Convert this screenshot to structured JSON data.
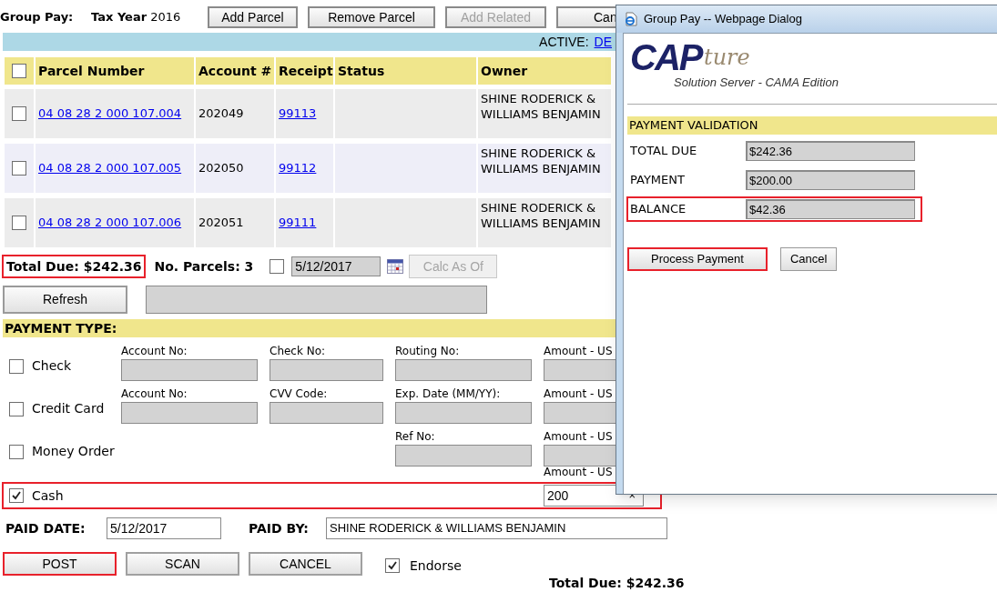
{
  "header": {
    "title": "Group Pay:",
    "tax_year_label": "Tax Year",
    "tax_year": "2016"
  },
  "toolbar": [
    {
      "label": "Add Parcel",
      "disabled": false
    },
    {
      "label": "Remove Parcel",
      "disabled": false
    },
    {
      "label": "Add Related",
      "disabled": true
    },
    {
      "label": "Can",
      "disabled": false
    }
  ],
  "active_bar": {
    "label": "ACTIVE:",
    "link": "DE"
  },
  "table": {
    "all_checked": false,
    "columns": [
      "Parcel Number",
      "Account #",
      "Receipt",
      "Status",
      "Owner"
    ],
    "rows": [
      {
        "checked": false,
        "parcel": "04 08 28 2 000 107.004",
        "account": "202049",
        "receipt": "99113",
        "owner": "SHINE RODERICK & WILLIAMS BENJAMIN"
      },
      {
        "checked": false,
        "parcel": "04 08 28 2 000 107.005",
        "account": "202050",
        "receipt": "99112",
        "owner": "SHINE RODERICK & WILLIAMS BENJAMIN"
      },
      {
        "checked": false,
        "parcel": "04 08 28 2 000 107.006",
        "account": "202051",
        "receipt": "99111",
        "owner": "SHINE RODERICK & WILLIAMS BENJAMIN"
      }
    ]
  },
  "summary": {
    "total_due": "Total Due: $242.36",
    "total_highlighted": true,
    "parcels": "No. Parcels: 3",
    "calc_checked": false,
    "calc_date": "5/12/2017",
    "calc_button": {
      "label": "Calc As Of",
      "disabled": true
    },
    "refresh": "Refresh"
  },
  "payment": {
    "title": "PAYMENT TYPE:",
    "methods": [
      {
        "label": "Check",
        "checked": false,
        "highlighted": false,
        "fields": [
          {
            "label": "Account No:"
          },
          {
            "label": "Check No:"
          },
          {
            "label": "Routing No:"
          },
          {
            "label": "Amount - US"
          }
        ]
      },
      {
        "label": "Credit Card",
        "checked": false,
        "highlighted": false,
        "fields": [
          {
            "label": "Account No:"
          },
          {
            "label": "CVV Code:"
          },
          {
            "label": "Exp. Date (MM/YY):"
          },
          {
            "label": "Amount - US"
          }
        ]
      },
      {
        "label": "Money Order",
        "checked": false,
        "highlighted": false,
        "fields": [
          {
            "label": "Ref No:"
          },
          {
            "label": "Amount - US"
          }
        ]
      },
      {
        "label": "Cash",
        "checked": true,
        "highlighted": true,
        "fields": [
          {
            "label": "Amount - US",
            "value": "200",
            "clear": "×"
          }
        ]
      }
    ]
  },
  "paid": {
    "date_label": "PAID DATE:",
    "date": "5/12/2017",
    "by_label": "PAID BY:",
    "by": "SHINE RODERICK & WILLIAMS BENJAMIN"
  },
  "actions": [
    {
      "label": "POST",
      "highlighted": true
    },
    {
      "label": "SCAN",
      "highlighted": false
    },
    {
      "label": "CANCEL",
      "highlighted": false
    }
  ],
  "endorse": {
    "label": "Endorse",
    "checked": true
  },
  "footer_total": "Total Due: $242.36",
  "dialog": {
    "title": "Group Pay -- Webpage Dialog",
    "logo": {
      "main": "CAP",
      "script": "ture",
      "subtitle": "Solution Server - CAMA Edition"
    },
    "section": "PAYMENT VALIDATION",
    "rows": [
      {
        "label": "TOTAL DUE",
        "value": "$242.36",
        "highlighted": false
      },
      {
        "label": "PAYMENT",
        "value": "$200.00",
        "highlighted": false
      },
      {
        "label": "BALANCE",
        "value": "$42.36",
        "highlighted": true
      }
    ],
    "buttons": [
      {
        "label": "Process Payment",
        "highlighted": true
      },
      {
        "label": "Cancel",
        "highlighted": false
      }
    ]
  }
}
